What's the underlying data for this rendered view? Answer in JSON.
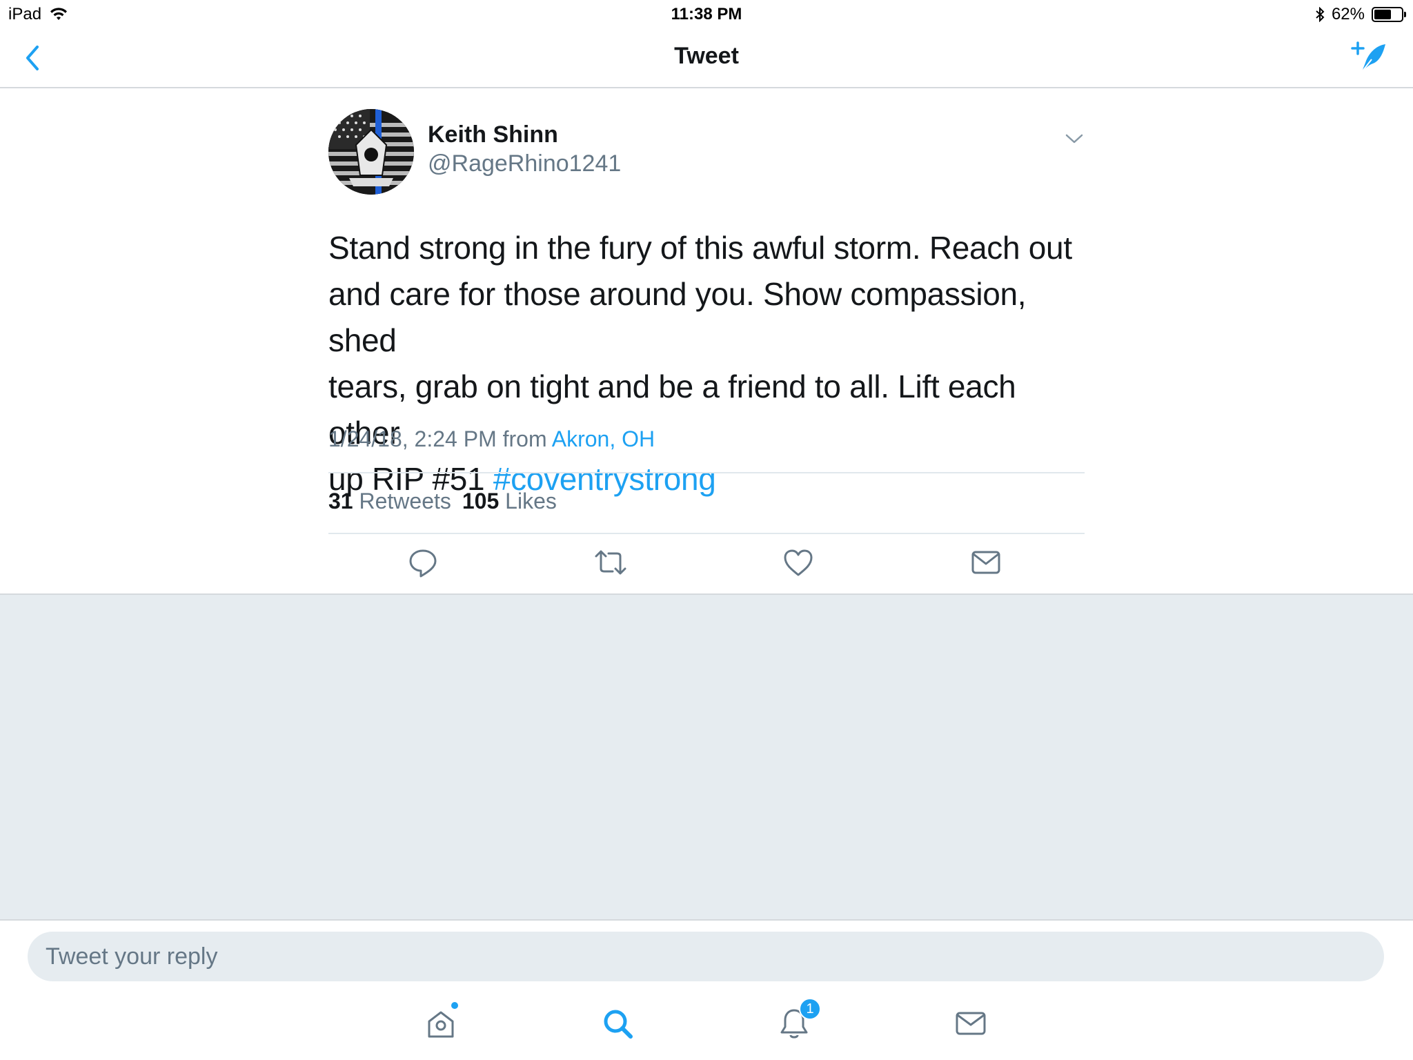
{
  "status_bar": {
    "device": "iPad",
    "time": "11:38 PM",
    "battery_percent": "62%",
    "battery_level": 0.62
  },
  "nav": {
    "title": "Tweet",
    "icons": {
      "back": "chevron-left-icon",
      "compose": "compose-tweet-icon"
    }
  },
  "tweet": {
    "author_name": "Keith Shinn",
    "author_handle": "@RageRhino1241",
    "text_line1": "Stand strong in the fury of this awful storm. Reach out",
    "text_line2": "and care for those around you. Show compassion, shed",
    "text_line3": "tears, grab on tight and be a friend to all. Lift each other",
    "text_line4_prefix": "up RIP #51 ",
    "hashtag": "#coventrystrong",
    "timestamp": "1/24/18, 2:24 PM",
    "from_label": "from",
    "location": "Akron, OH",
    "retweet_count": "31",
    "retweet_label": "Retweets",
    "like_count": "105",
    "like_label": "Likes",
    "actions": [
      "reply-icon",
      "retweet-icon",
      "like-icon",
      "direct-message-icon"
    ]
  },
  "reply": {
    "placeholder": "Tweet your reply"
  },
  "tab_bar": {
    "tabs": [
      "home-icon",
      "search-icon",
      "notifications-icon",
      "messages-icon"
    ],
    "notification_badge": "1"
  },
  "colors": {
    "accent": "#1da1f2",
    "secondary_text": "#657786",
    "background_gray": "#e6ecf0"
  }
}
